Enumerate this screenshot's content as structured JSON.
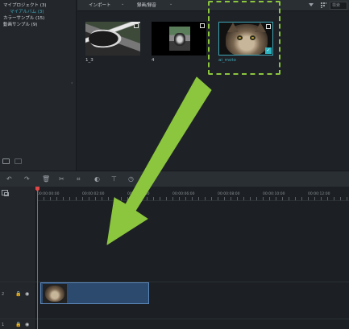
{
  "sidebar": {
    "items": [
      {
        "label": "マイプロジェクト (3)",
        "sub": false
      },
      {
        "label": "マイアルバム (3)",
        "sub": true
      },
      {
        "label": "カラーサンプル (15)",
        "sub": false
      },
      {
        "label": "動画サンプル (9)",
        "sub": false
      }
    ],
    "toggle_icon": "chevron-left-icon",
    "add_folder_icon": "folder-add-icon",
    "folder_icon": "folder-icon"
  },
  "media_toolbar": {
    "import_label": "インポート",
    "record_label": "録画/録音",
    "search_placeholder": "検索"
  },
  "media_items": [
    {
      "label": "1_3",
      "selected": false
    },
    {
      "label": "4",
      "selected": false
    },
    {
      "label": "ai_moto",
      "selected": true
    }
  ],
  "edit_toolbar": {
    "icons": [
      "undo-icon",
      "redo-icon",
      "delete-icon",
      "cut-icon",
      "crop-icon",
      "color-icon",
      "split-icon",
      "speed-icon"
    ]
  },
  "timeline": {
    "ruler_labels": [
      "00:00:00:00",
      "00:00:02:00",
      "00:00:04:00",
      "00:00:06:00",
      "00:00:08:00",
      "00:00:10:00",
      "00:00:12:00"
    ],
    "tracks": [
      {
        "label": "2"
      },
      {
        "label": "1"
      }
    ]
  },
  "colors": {
    "accent": "#3fa7b8",
    "highlight": "#8cc63f",
    "playhead": "#e04848",
    "clip": "#2c4a6e"
  }
}
